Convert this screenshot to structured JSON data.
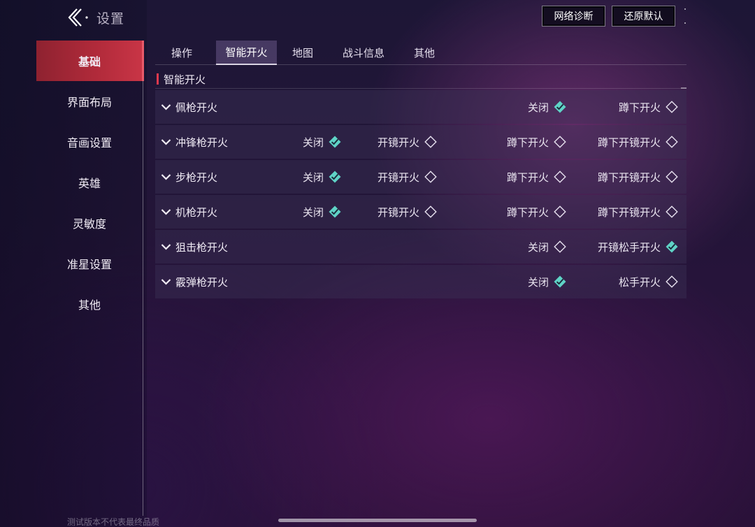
{
  "header": {
    "title": "设置",
    "buttons": {
      "network_diag": "网络诊断",
      "reset_default": "还原默认"
    }
  },
  "sidebar": {
    "items": [
      {
        "label": "基础",
        "active": true
      },
      {
        "label": "界面布局",
        "active": false
      },
      {
        "label": "音画设置",
        "active": false
      },
      {
        "label": "英雄",
        "active": false
      },
      {
        "label": "灵敏度",
        "active": false
      },
      {
        "label": "准星设置",
        "active": false
      },
      {
        "label": "其他",
        "active": false
      }
    ]
  },
  "tabs": [
    {
      "label": "操作",
      "active": false
    },
    {
      "label": "智能开火",
      "active": true
    },
    {
      "label": "地图",
      "active": false
    },
    {
      "label": "战斗信息",
      "active": false
    },
    {
      "label": "其他",
      "active": false
    }
  ],
  "section": {
    "title": "智能开火"
  },
  "rows": [
    {
      "label": "佩枪开火",
      "options": [
        {
          "label": "关闭",
          "checked": true
        },
        {
          "label": "蹲下开火",
          "checked": false
        }
      ]
    },
    {
      "label": "冲锋枪开火",
      "options": [
        {
          "label": "关闭",
          "checked": true
        },
        {
          "label": "开镜开火",
          "checked": false
        },
        {
          "label": "蹲下开火",
          "checked": false
        },
        {
          "label": "蹲下开镜开火",
          "checked": false
        }
      ]
    },
    {
      "label": "步枪开火",
      "options": [
        {
          "label": "关闭",
          "checked": true
        },
        {
          "label": "开镜开火",
          "checked": false
        },
        {
          "label": "蹲下开火",
          "checked": false
        },
        {
          "label": "蹲下开镜开火",
          "checked": false
        }
      ]
    },
    {
      "label": "机枪开火",
      "options": [
        {
          "label": "关闭",
          "checked": true
        },
        {
          "label": "开镜开火",
          "checked": false
        },
        {
          "label": "蹲下开火",
          "checked": false
        },
        {
          "label": "蹲下开镜开火",
          "checked": false
        }
      ]
    },
    {
      "label": "狙击枪开火",
      "options": [
        {
          "label": "关闭",
          "checked": false
        },
        {
          "label": "开镜松手开火",
          "checked": true
        }
      ]
    },
    {
      "label": "霰弹枪开火",
      "options": [
        {
          "label": "关闭",
          "checked": true
        },
        {
          "label": "松手开火",
          "checked": false
        }
      ]
    }
  ],
  "footer": {
    "watermark": "测试版本不代表最终品质"
  },
  "colors": {
    "accent_red": "#c93546",
    "check_teal": "#5fd3c6"
  },
  "icons": {
    "back": "back-arrow-icon",
    "expand": "chevron-down-icon",
    "checked": "diamond-checked-icon",
    "unchecked": "diamond-empty-icon"
  }
}
